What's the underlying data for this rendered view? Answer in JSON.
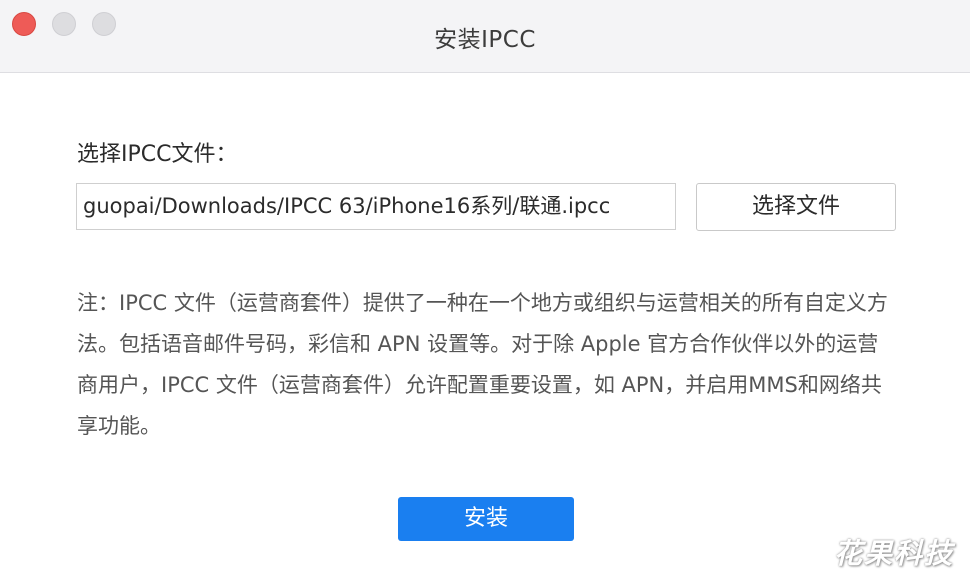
{
  "window": {
    "title": "安装IPCC"
  },
  "form": {
    "label": "选择IPCC文件：",
    "path_value": "guopai/Downloads/IPCC 63/iPhone16系列/联通.ipcc",
    "choose_button_label": "选择文件"
  },
  "note": {
    "text": "注：IPCC 文件（运营商套件）提供了一种在一个地方或组织与运营相关的所有自定义方法。包括语音邮件号码，彩信和 APN 设置等。对于除 Apple 官方合作伙伴以外的运营商用户，IPCC 文件（运营商套件）允许配置重要设置，如 APN，并启用MMS和网络共享功能。"
  },
  "actions": {
    "install_label": "安装"
  },
  "watermark": {
    "text": "花果科技"
  },
  "colors": {
    "accent": "#1a7ff0",
    "close_light": "#ee5b57",
    "inactive_light": "#dddde0"
  }
}
